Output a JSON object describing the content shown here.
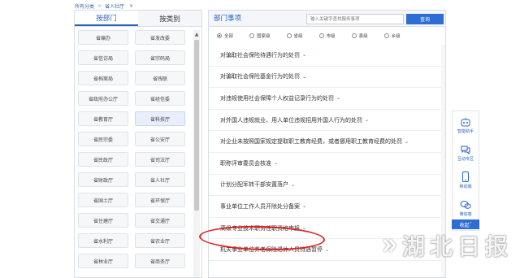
{
  "breadcrumb": {
    "root": "所有分类",
    "separator": ">",
    "current": "省人社厅",
    "close": "×"
  },
  "left_tabs": [
    {
      "label": "按部门",
      "active": true
    },
    {
      "label": "按类别",
      "active": false
    }
  ],
  "departments": [
    "省编办",
    "省发改委",
    "省信访局",
    "省宗码局",
    "省档案局",
    "省残联",
    "省政府办公厅",
    "省经信委",
    "省教育厅",
    "省科技厅",
    "省民宗委",
    "省公安厅",
    "省民政厅",
    "省司法厅",
    "省财政厅",
    "省人社厅",
    "省国土厅",
    "省环保厅",
    "省住建厅",
    "省交通厅",
    "省水利厅",
    "省农业厅",
    "省林业厅",
    "省商务厅"
  ],
  "selected_department_index": 9,
  "right_panel": {
    "title": "部门事项",
    "search_placeholder": "输入关键字查找服务事项",
    "search_button": "查询"
  },
  "levels": [
    {
      "label": "全部",
      "selected": true
    },
    {
      "label": "国家级",
      "selected": false
    },
    {
      "label": "省级",
      "selected": false
    },
    {
      "label": "市级",
      "selected": false
    },
    {
      "label": "县级",
      "selected": false
    },
    {
      "label": "乡级",
      "selected": false
    }
  ],
  "items": [
    "对骗取社会保险待遇行为的处罚",
    "对骗取社会保险基金行为的处罚",
    "对违规使用社会保障个人权益记录行为的处罚",
    "对外国人违规就业、用人单位违规招用外国人行为的处罚",
    "对企业未按照国家规定提取职工教育经费，或者挪用职工教育经费的处罚",
    "职称评审委员会核准",
    "计划分配军转干部安置落户",
    "事业单位工作人员开除处分备案",
    "高级专业技术职务任职资格申报",
    "机关事业单位养老保险退休人员待遇暂停"
  ],
  "side_widget": [
    {
      "icon": "robot-icon",
      "label": "智能助手"
    },
    {
      "icon": "chat-icon",
      "label": "互动专区"
    },
    {
      "icon": "phone-icon",
      "label": "移动端"
    },
    {
      "icon": "wechat-icon",
      "label": "微信端"
    }
  ],
  "collapse_label": "收起",
  "watermark": "湖北日报",
  "colors": {
    "accent": "#2e6ed3",
    "highlight": "#e02020"
  }
}
